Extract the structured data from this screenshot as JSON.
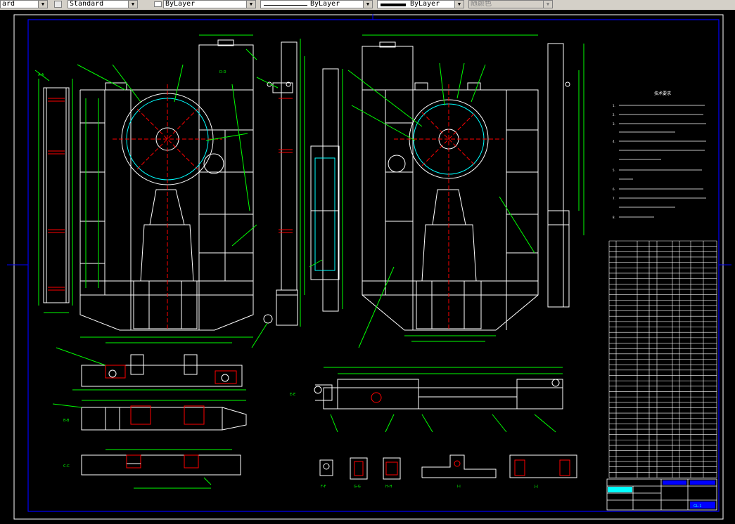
{
  "toolbar": {
    "layer_combo_value": "ard",
    "textstyle_combo_value": "Standard",
    "color_combo_value": "ByLayer",
    "linetype_combo_value": "ByLayer",
    "lineweight_combo_value": "ByLayer",
    "plotstyle_combo_value": "随颜色"
  },
  "drawing": {
    "section_labels": {
      "aa": "A-A",
      "dd": "D-D",
      "bb": "B-B",
      "cc": "C-C",
      "ee": "E-E",
      "ff": "F-F",
      "gg": "G-G",
      "hh": "H-H",
      "ii": "I-I",
      "jj": "J-J"
    },
    "notes_title": "技术要求",
    "notes": [
      "1.",
      "2.",
      "3.",
      "4.",
      "5.",
      "6.",
      "7.",
      "8."
    ],
    "part_numbers_left": [
      "1",
      "2",
      "3",
      "4",
      "5",
      "6",
      "7",
      "8",
      "9",
      "10",
      "11",
      "12",
      "13",
      "14",
      "15",
      "16",
      "17",
      "18",
      "19",
      "20",
      "21",
      "22",
      "23",
      "24",
      "25",
      "26",
      "27",
      "28",
      "29",
      "30",
      "31",
      "32",
      "33",
      "34",
      "35",
      "36",
      "37",
      "38",
      "39",
      "40"
    ],
    "title_block": {
      "drawing_no": "GL-1"
    }
  },
  "colors": {
    "background": "#000000",
    "geometry": "#ffffff",
    "dimension": "#00ff00",
    "center": "#ff0000",
    "hidden": "#00ffff",
    "frame": "#0000ff",
    "toolbar": "#d4d0c8"
  }
}
